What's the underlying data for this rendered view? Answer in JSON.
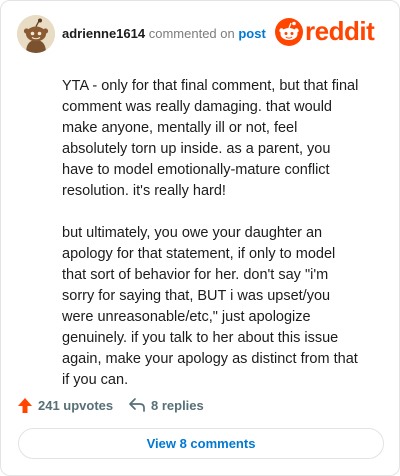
{
  "header": {
    "username": "adrienne1614",
    "action_text": "commented on",
    "post_link": "post",
    "logo_text": "reddit"
  },
  "comment": {
    "paragraphs": [
      "YTA - only for that final comment, but that final comment was really damaging. that would make anyone, mentally ill or not, feel absolutely torn up inside. as a parent, you have to model emotionally-mature conflict resolution. it's really hard!",
      "but ultimately, you owe your daughter an apology for that statement, if only to model that sort of behavior for her. don't say \"i'm sorry for saying that, BUT i was upset/you were unreasonable/etc,\" just apologize genuinely. if you talk to her about this issue again, make your apology as distinct from that if you can."
    ]
  },
  "stats": {
    "upvotes": "241 upvotes",
    "replies": "8 replies"
  },
  "footer": {
    "view_button": "View 8 comments"
  },
  "colors": {
    "brand": "#ff4500",
    "link": "#0079d3",
    "muted": "#7c7c7c"
  },
  "icons": {
    "avatar": "snoo-avatar-icon",
    "logo": "reddit-snoo-icon",
    "upvote": "upvote-arrow-icon",
    "reply": "reply-arrow-icon"
  }
}
